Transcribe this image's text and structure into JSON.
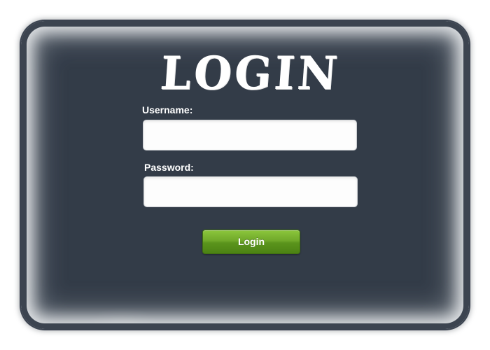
{
  "form": {
    "title": "LOGIN",
    "username_label": "Username:",
    "username_value": "",
    "password_label": "Password:",
    "password_value": "",
    "submit_label": "Login"
  },
  "colors": {
    "frame": "#323b48",
    "button_top": "#8cc63c",
    "button_bottom": "#4c8214",
    "text": "#ffffff"
  }
}
